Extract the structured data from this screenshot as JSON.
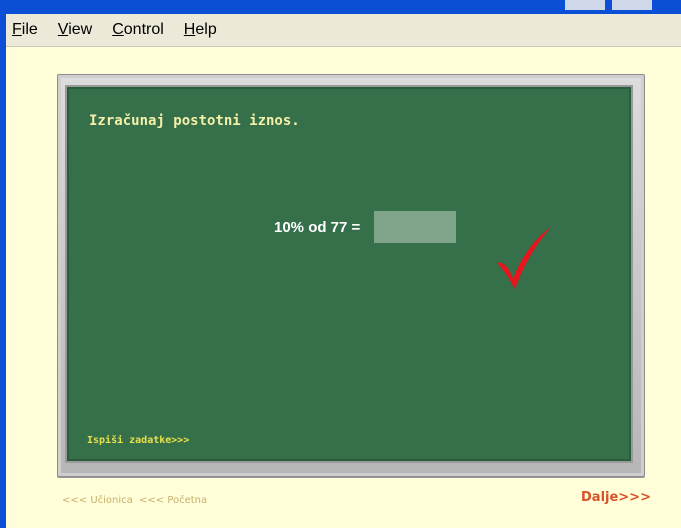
{
  "menu": {
    "file": {
      "underline": "F",
      "rest": "ile"
    },
    "view": {
      "underline": "V",
      "rest": "iew"
    },
    "control": {
      "underline": "C",
      "rest": "ontrol"
    },
    "help": {
      "underline": "H",
      "rest": "elp"
    }
  },
  "board": {
    "instruction": "Izračunaj postotni iznos.",
    "equation": "10% od 77 =",
    "answer_value": "",
    "print_tasks": "Ispiši zadatke>>>"
  },
  "footer": {
    "classroom": "<<< Učionica",
    "home": "<<< Početna",
    "next": "Dalje>>>"
  },
  "colors": {
    "board": "#36704a",
    "checkmark": "#e8141e",
    "next": "#d8522a"
  },
  "icons": {
    "check": "check-mark-icon"
  }
}
